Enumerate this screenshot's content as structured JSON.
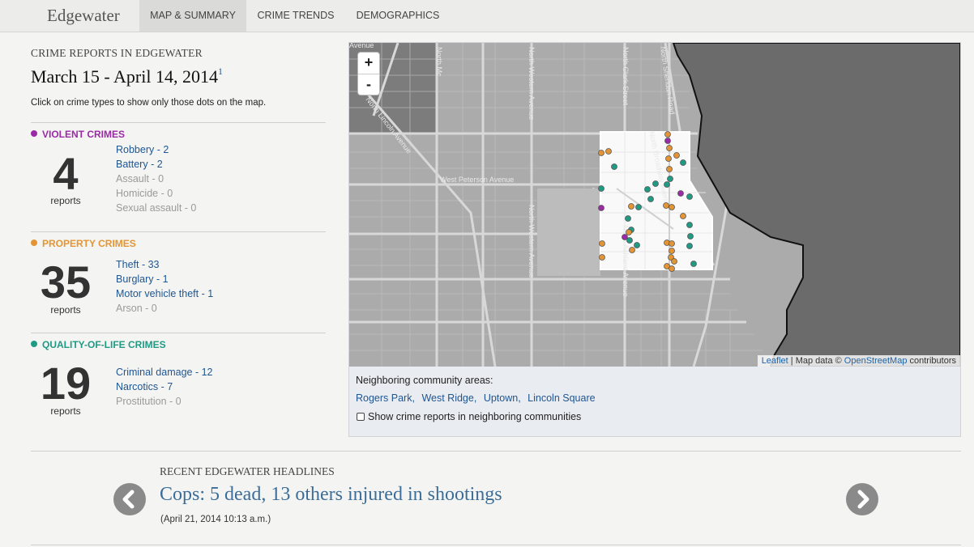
{
  "nav": {
    "brand": "Edgewater",
    "tabs": [
      "MAP & SUMMARY",
      "CRIME TRENDS",
      "DEMOGRAPHICS"
    ],
    "active_tab": "MAP & SUMMARY"
  },
  "summary": {
    "overline": "CRIME REPORTS IN EDGEWATER",
    "date_range": "March 15 - April 14, 2014",
    "footnote": "1",
    "instructions": "Click on crime types to show only those dots on the map.",
    "categories": [
      {
        "heading": "VIOLENT CRIMES",
        "color": "#9b2aa6",
        "count": "4",
        "count_label": "reports",
        "items": [
          {
            "label": "Robbery - 2",
            "active": true
          },
          {
            "label": "Battery - 2",
            "active": true
          },
          {
            "label": "Assault - 0",
            "active": false
          },
          {
            "label": "Homicide - 0",
            "active": false
          },
          {
            "label": "Sexual assault - 0",
            "active": false
          }
        ]
      },
      {
        "heading": "PROPERTY CRIMES",
        "color": "#e39535",
        "count": "35",
        "count_label": "reports",
        "items": [
          {
            "label": "Theft - 33",
            "active": true
          },
          {
            "label": "Burglary - 1",
            "active": true
          },
          {
            "label": "Motor vehicle theft - 1",
            "active": true
          },
          {
            "label": "Arson - 0",
            "active": false
          }
        ]
      },
      {
        "heading": "QUALITY-OF-LIFE CRIMES",
        "color": "#1f9a84",
        "count": "19",
        "count_label": "reports",
        "items": [
          {
            "label": "Criminal damage - 12",
            "active": true
          },
          {
            "label": "Narcotics - 7",
            "active": true
          },
          {
            "label": "Prostitution - 0",
            "active": false
          }
        ]
      }
    ]
  },
  "map": {
    "zoom_in": "+",
    "zoom_out": "-",
    "street_labels": [
      "North Clark Street",
      "North Sheridan Road",
      "North Western Avenue",
      "North Lincoln Avenue",
      "West Peterson Avenue",
      "North Broadway Avenue",
      "North Ashland Avenue",
      "North Western Avenue",
      "Avenue",
      "North Mc"
    ],
    "attribution_leaflet": "Leaflet",
    "attribution_text": "| Map data ©",
    "attribution_osm": "OpenStreetMap",
    "attribution_suffix": "contributors",
    "marker_colors": {
      "violent": "#9b2aa6",
      "property": "#e39535",
      "quality": "#1f9a84"
    }
  },
  "neighbors": {
    "label": "Neighboring community areas:",
    "links": [
      "Rogers Park",
      "West Ridge",
      "Uptown",
      "Lincoln Square"
    ],
    "checkbox_label": "Show crime reports in neighboring communities",
    "checkbox_checked": false
  },
  "headlines": {
    "label": "RECENT EDGEWATER HEADLINES",
    "title": "Cops: 5 dead, 13 others injured in shootings",
    "date": "(April 21, 2014 10:13 a.m.)"
  }
}
